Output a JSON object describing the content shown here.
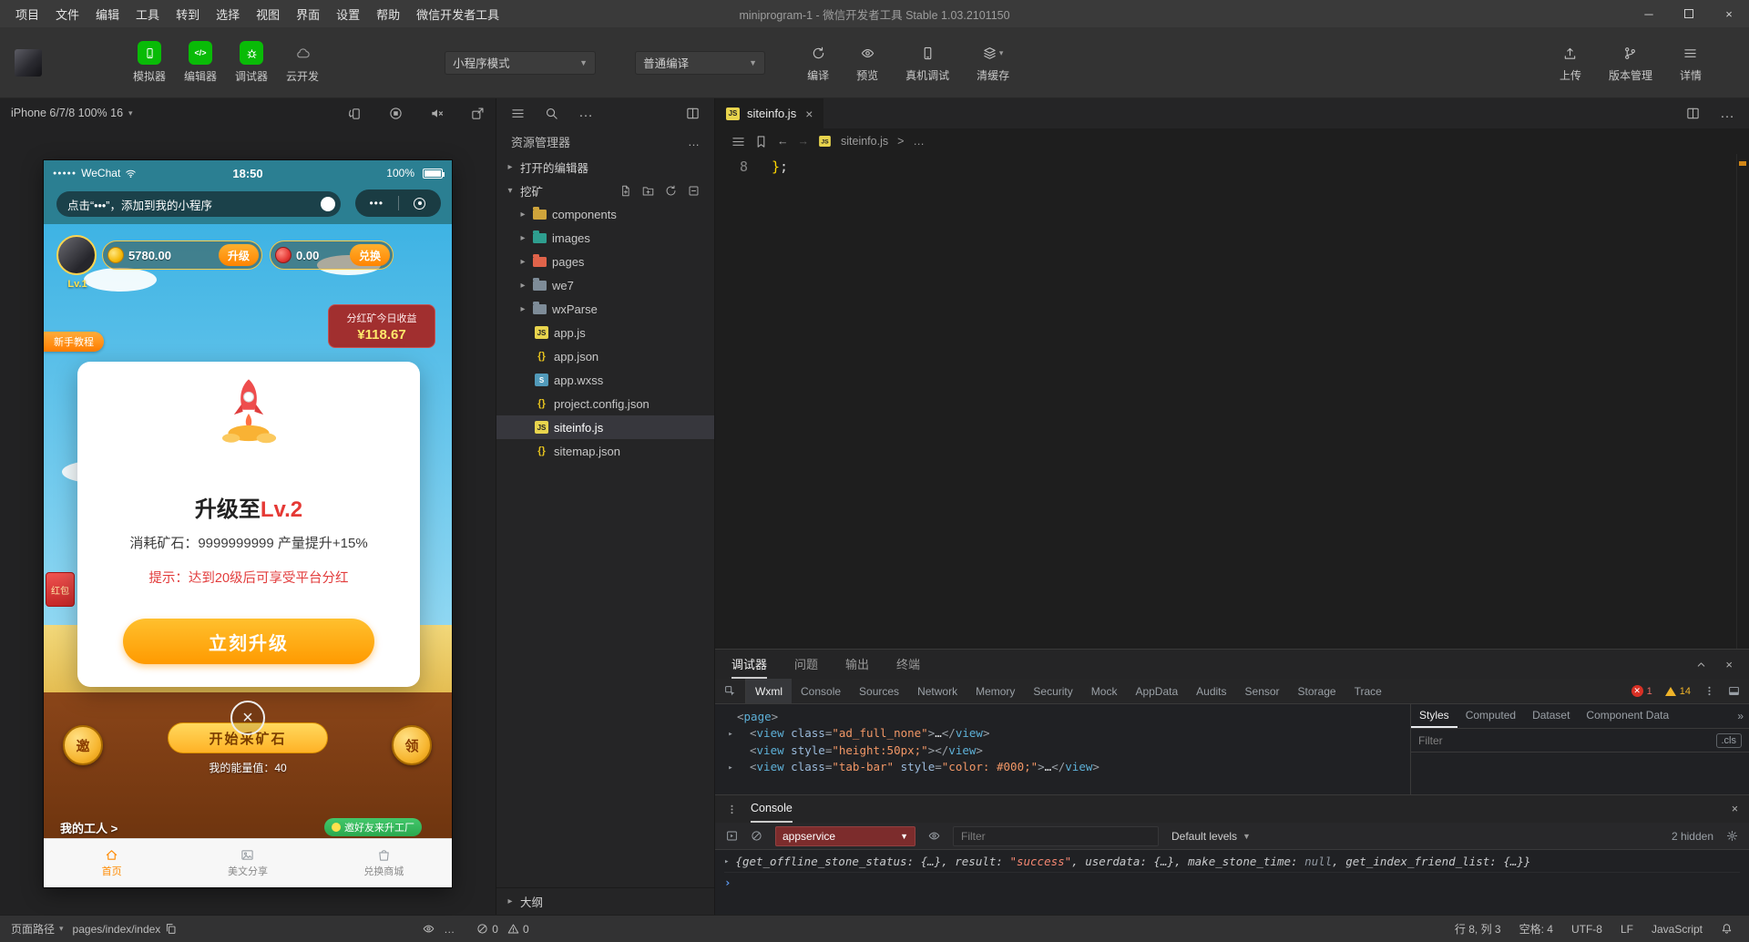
{
  "icons": {
    "caret_down": "▾",
    "select_arrow": "▼",
    "tri_right": "▸",
    "tri_down": "▾",
    "close": "×",
    "ellipsis": "…",
    "back": "←",
    "forward": "→",
    "gt": ">",
    "chevrons": "»",
    "prompt": "›",
    "minimize": "─",
    "code_glyph": "</>"
  },
  "titlebar": {
    "menus": [
      "项目",
      "文件",
      "编辑",
      "工具",
      "转到",
      "选择",
      "视图",
      "界面",
      "设置",
      "帮助",
      "微信开发者工具"
    ],
    "title": "miniprogram-1 - 微信开发者工具 Stable 1.03.2101150"
  },
  "toolbar": {
    "simulator": "模拟器",
    "editor": "编辑器",
    "debugger": "调试器",
    "cloud": "云开发",
    "mode_select": "小程序模式",
    "compile_select": "普通编译",
    "compile": "编译",
    "preview": "预览",
    "device_debug": "真机调试",
    "clear_cache": "清缓存",
    "upload": "上传",
    "version": "版本管理",
    "details": "详情"
  },
  "simulator": {
    "device_label": "iPhone 6/7/8 100% 16"
  },
  "phone": {
    "status": {
      "signal": "●●●●●",
      "carrier": "WeChat",
      "time": "18:50",
      "battery": "100%"
    },
    "tooltip": "点击“•••”，添加到我的小程序",
    "capsule_dots": "•••",
    "player": {
      "level": "Lv.1",
      "coins": "5780.00",
      "upgrade_btn": "升级",
      "gems": "0.00",
      "exchange_btn": "兑换"
    },
    "income": {
      "label": "分红矿今日收益",
      "value": "¥118.67"
    },
    "tutorial_badge": "新手教程",
    "red_packet": "红包",
    "modal": {
      "title_prefix": "升级至",
      "title_level": "Lv.2",
      "desc": "消耗矿石：9999999999 产量提升+15%",
      "hint": "提示：达到20级后可享受平台分红",
      "confirm_btn": "立刻升级"
    },
    "bottom": {
      "invite_circle": "邀",
      "mine_btn": "开始采矿石",
      "energy": "我的能量值：40",
      "claim_circle": "领"
    },
    "workers": "我的工人 >",
    "invite_banner": "邀好友来升工厂",
    "tabbar": {
      "home": "首页",
      "share": "美文分享",
      "shop": "兑换商城"
    }
  },
  "explorer": {
    "title": "资源管理器",
    "open_editors": "打开的编辑器",
    "project": "挖矿",
    "files": [
      {
        "name": "components"
      },
      {
        "name": "images"
      },
      {
        "name": "pages"
      },
      {
        "name": "we7"
      },
      {
        "name": "wxParse"
      },
      {
        "name": "app.js"
      },
      {
        "name": "app.json"
      },
      {
        "name": "app.wxss"
      },
      {
        "name": "project.config.json"
      },
      {
        "name": "siteinfo.js"
      },
      {
        "name": "sitemap.json"
      }
    ],
    "outline": "大纲"
  },
  "editor": {
    "tab": "siteinfo.js",
    "breadcrumb_file": "siteinfo.js",
    "line_no": "8",
    "code_segs": [
      {
        "t": "}",
        "c": "bracket"
      },
      {
        "t": ";",
        "c": "plain"
      }
    ]
  },
  "debug": {
    "tabs": [
      "调试器",
      "问题",
      "输出",
      "终端"
    ],
    "devtools_tabs": [
      "Wxml",
      "Console",
      "Sources",
      "Network",
      "Memory",
      "Security",
      "Mock",
      "AppData",
      "Audits",
      "Sensor",
      "Storage",
      "Trace"
    ],
    "error_count": "1",
    "warn_count": "14",
    "wxml": {
      "line1": [
        {
          "t": "<",
          "c": "p"
        },
        {
          "t": "page",
          "c": "tag"
        },
        {
          "t": ">",
          "c": "p"
        }
      ],
      "line2": [
        {
          "t": "<",
          "c": "p"
        },
        {
          "t": "view",
          "c": "tag"
        },
        {
          "t": " ",
          "c": "p"
        },
        {
          "t": "class",
          "c": "attr"
        },
        {
          "t": "=",
          "c": "p"
        },
        {
          "t": "\"ad_full_none\"",
          "c": "val"
        },
        {
          "t": ">",
          "c": "p"
        },
        {
          "t": "…",
          "c": "text"
        },
        {
          "t": "</",
          "c": "p"
        },
        {
          "t": "view",
          "c": "tag"
        },
        {
          "t": ">",
          "c": "p"
        }
      ],
      "line3": [
        {
          "t": "<",
          "c": "p"
        },
        {
          "t": "view",
          "c": "tag"
        },
        {
          "t": " ",
          "c": "p"
        },
        {
          "t": "style",
          "c": "attr"
        },
        {
          "t": "=",
          "c": "p"
        },
        {
          "t": "\"height:50px;\"",
          "c": "val"
        },
        {
          "t": ">",
          "c": "p"
        },
        {
          "t": "</",
          "c": "p"
        },
        {
          "t": "view",
          "c": "tag"
        },
        {
          "t": ">",
          "c": "p"
        }
      ],
      "line4": [
        {
          "t": "<",
          "c": "p"
        },
        {
          "t": "view",
          "c": "tag"
        },
        {
          "t": " ",
          "c": "p"
        },
        {
          "t": "class",
          "c": "attr"
        },
        {
          "t": "=",
          "c": "p"
        },
        {
          "t": "\"tab-bar\"",
          "c": "val"
        },
        {
          "t": " ",
          "c": "p"
        },
        {
          "t": "style",
          "c": "attr"
        },
        {
          "t": "=",
          "c": "p"
        },
        {
          "t": "\"color: #000;\"",
          "c": "val"
        },
        {
          "t": ">",
          "c": "p"
        },
        {
          "t": "…",
          "c": "text"
        },
        {
          "t": "</",
          "c": "p"
        },
        {
          "t": "view",
          "c": "tag"
        },
        {
          "t": ">",
          "c": "p"
        }
      ]
    },
    "styles_tabs": [
      "Styles",
      "Computed",
      "Dataset",
      "Component Data"
    ],
    "filter_placeholder": "Filter",
    "cls_btn": ".cls"
  },
  "console": {
    "tab": "Console",
    "context": "appservice",
    "filter_placeholder": "Filter",
    "levels": "Default levels",
    "hidden": "2 hidden",
    "log": [
      {
        "t": "{get_offline_stone_status: {…}, result: ",
        "c": "cp"
      },
      {
        "t": "\"success\"",
        "c": "cs"
      },
      {
        "t": ", userdata: {…}, make_stone_time: ",
        "c": "cp"
      },
      {
        "t": "null",
        "c": "cn"
      },
      {
        "t": ", get_index_friend_list: {…}}",
        "c": "cp"
      }
    ]
  },
  "status": {
    "page_path_label": "页面路径",
    "page_path": "pages/index/index",
    "errors": "0",
    "warnings": "0",
    "cursor": "行 8, 列 3",
    "indent": "空格: 4",
    "encoding": "UTF-8",
    "eol": "LF",
    "lang": "JavaScript"
  }
}
